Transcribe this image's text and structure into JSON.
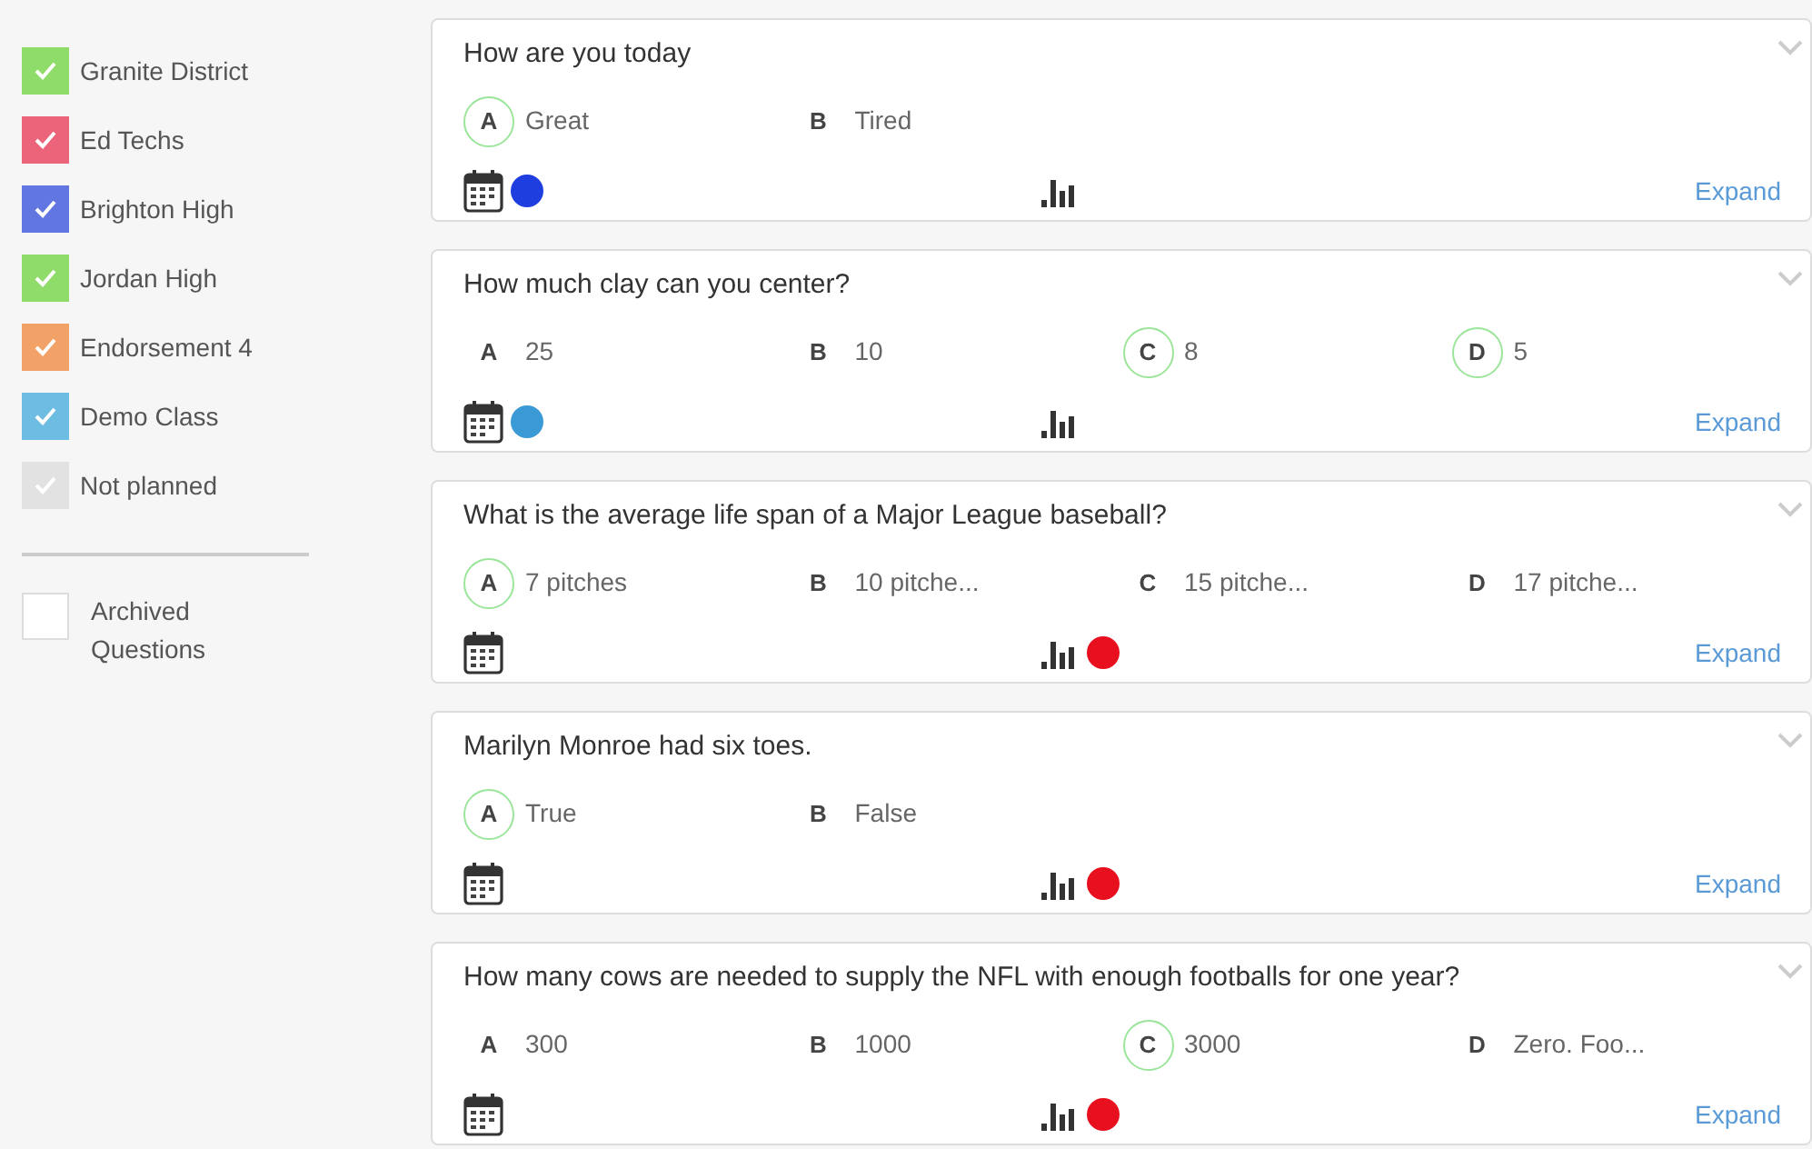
{
  "sidebar": {
    "groups": [
      {
        "label": "Granite District",
        "color": "#8fdc6a",
        "checked": true
      },
      {
        "label": "Ed Techs",
        "color": "#ec6479",
        "checked": true
      },
      {
        "label": "Brighton High",
        "color": "#6176e0",
        "checked": true
      },
      {
        "label": "Jordan High",
        "color": "#8fdc6a",
        "checked": true
      },
      {
        "label": "Endorsement 4",
        "color": "#f2a266",
        "checked": true
      },
      {
        "label": "Demo Class",
        "color": "#6dbce2",
        "checked": true
      },
      {
        "label": "Not planned",
        "color": "#e2e2e2",
        "checked": true
      }
    ],
    "archived": {
      "label": "Archived Questions",
      "checked": false
    }
  },
  "questions": [
    {
      "question": "How are you today",
      "answers": [
        {
          "letter": "A",
          "text": "Great",
          "correct": true
        },
        {
          "letter": "B",
          "text": "Tired",
          "correct": false
        }
      ],
      "calendar_status": {
        "color": "#1e3ee0"
      },
      "action": "Expand"
    },
    {
      "question": "How much clay can you center?",
      "answers": [
        {
          "letter": "A",
          "text": "25",
          "correct": false
        },
        {
          "letter": "B",
          "text": "10",
          "correct": false
        },
        {
          "letter": "C",
          "text": "8",
          "correct": true
        },
        {
          "letter": "D",
          "text": "5",
          "correct": true
        }
      ],
      "calendar_status": {
        "color": "#3a9ad6"
      },
      "action": "Expand"
    },
    {
      "question": "What is the average life span of a Major League baseball?",
      "answers": [
        {
          "letter": "A",
          "text": "7 pitches",
          "correct": true
        },
        {
          "letter": "B",
          "text": "10 pitche...",
          "correct": false
        },
        {
          "letter": "C",
          "text": "15 pitche...",
          "correct": false
        },
        {
          "letter": "D",
          "text": "17 pitche...",
          "correct": false
        }
      ],
      "chart_status": {
        "color": "#e8101e"
      },
      "action": "Expand"
    },
    {
      "question": "Marilyn Monroe had six toes.",
      "answers": [
        {
          "letter": "A",
          "text": "True",
          "correct": true
        },
        {
          "letter": "B",
          "text": "False",
          "correct": false
        }
      ],
      "chart_status": {
        "color": "#e8101e"
      },
      "action": "Expand"
    },
    {
      "question": "How many cows are needed to supply the NFL with enough footballs for one year?",
      "answers": [
        {
          "letter": "A",
          "text": "300",
          "correct": false
        },
        {
          "letter": "B",
          "text": "1000",
          "correct": false
        },
        {
          "letter": "C",
          "text": "3000",
          "correct": true
        },
        {
          "letter": "D",
          "text": "Zero. Foo...",
          "correct": false
        }
      ],
      "chart_status": {
        "color": "#e8101e"
      },
      "action": "Expand"
    }
  ]
}
